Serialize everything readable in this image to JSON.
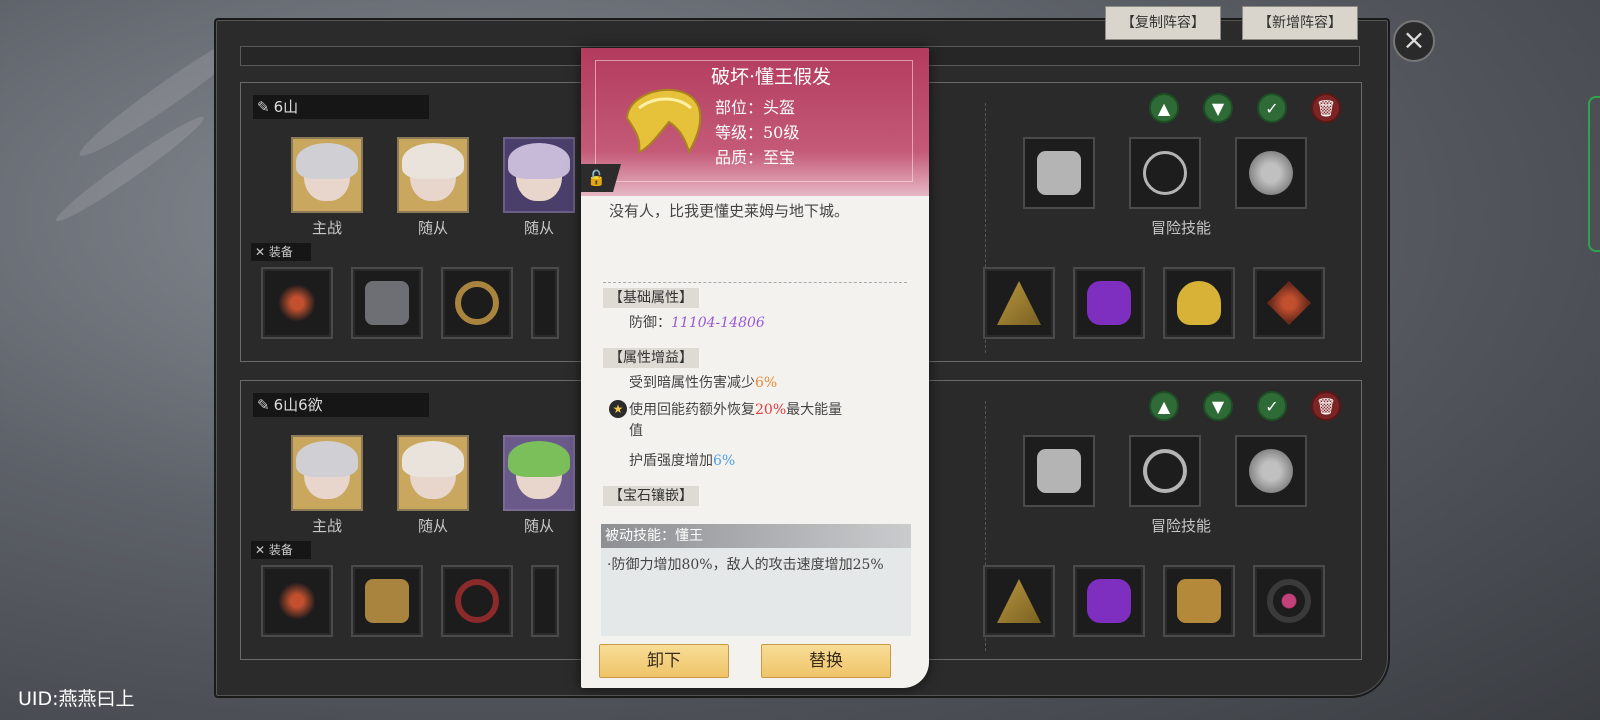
{
  "top_buttons": {
    "copy_label": "【复制阵容】",
    "new_label": "【新增阵容】"
  },
  "close_icon": "×",
  "teams": [
    {
      "name": "6山",
      "chars": [
        "主战",
        "随从",
        "随从"
      ],
      "equip_tag": "装备",
      "skill_label": "冒险技能"
    },
    {
      "name": "6山6欲",
      "chars": [
        "主战",
        "随从",
        "随从"
      ],
      "equip_tag": "装备",
      "skill_label": "冒险技能"
    }
  ],
  "popup": {
    "title": "破坏·懂王假发",
    "slot": "部位：头盔",
    "level": "等级：50级",
    "quality": "品质：至宝",
    "flavor": "没有人，比我更懂史莱姆与地下城。",
    "base_head": "【基础属性】",
    "base_label": "防御：",
    "base_range": "11104-14806",
    "bonus_head": "【属性增益】",
    "bonus1_pre": "受到暗属性伤害减少",
    "bonus1_val": "6%",
    "bonus2_pre": "使用回能药额外恢复",
    "bonus2_val": "20%",
    "bonus2_post": "最大能量",
    "bonus2_cont": "值",
    "bonus3_pre": "护盾强度增加",
    "bonus3_val": "6%",
    "gem_head": "【宝石镶嵌】",
    "passive_head": "被动技能：懂王",
    "passive_text": "·防御力增加80%，敌人的攻击速度增加25%",
    "unequip_label": "卸下",
    "replace_label": "替换"
  },
  "uid": "UID:燕燕曰上"
}
